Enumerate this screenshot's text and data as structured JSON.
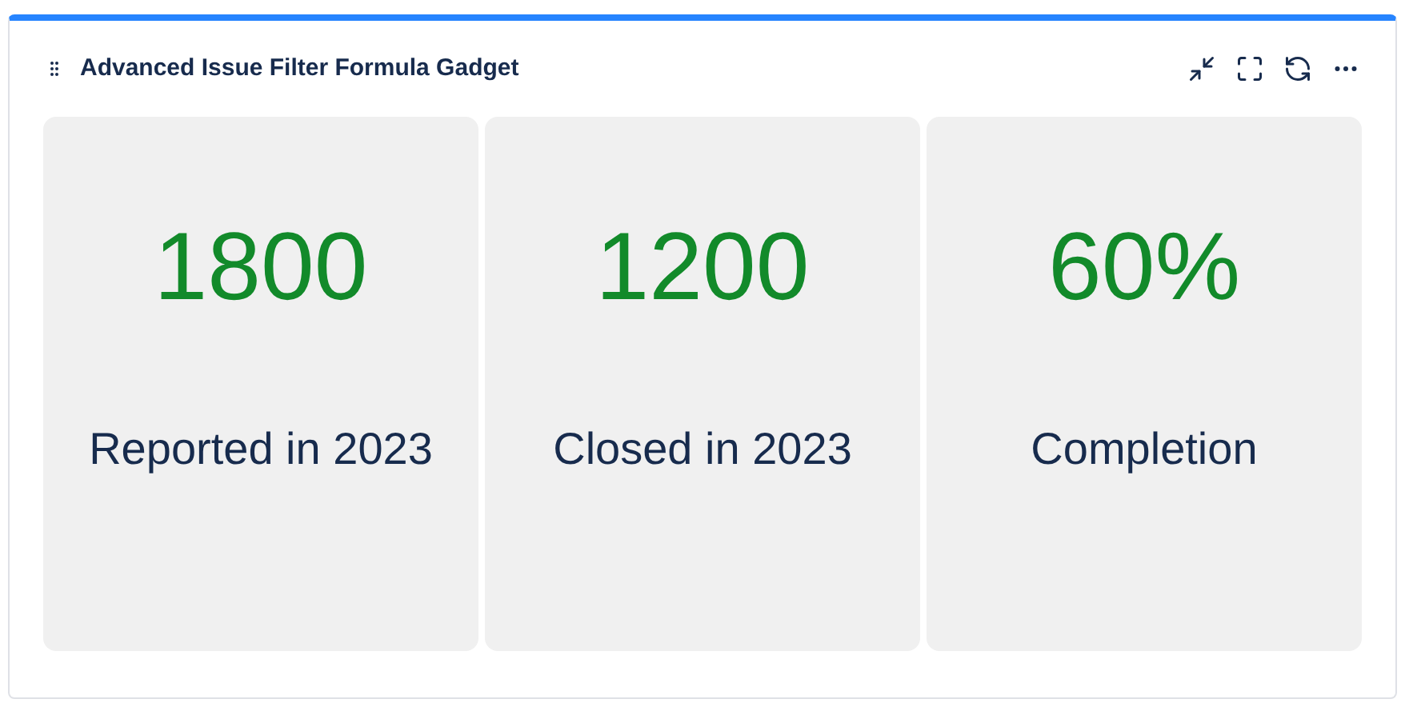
{
  "gadget": {
    "title": "Advanced Issue Filter Formula Gadget"
  },
  "cards": [
    {
      "value": "1800",
      "label": "Reported in 2023"
    },
    {
      "value": "1200",
      "label": "Closed in 2023"
    },
    {
      "value": "60%",
      "label": "Completion"
    }
  ]
}
